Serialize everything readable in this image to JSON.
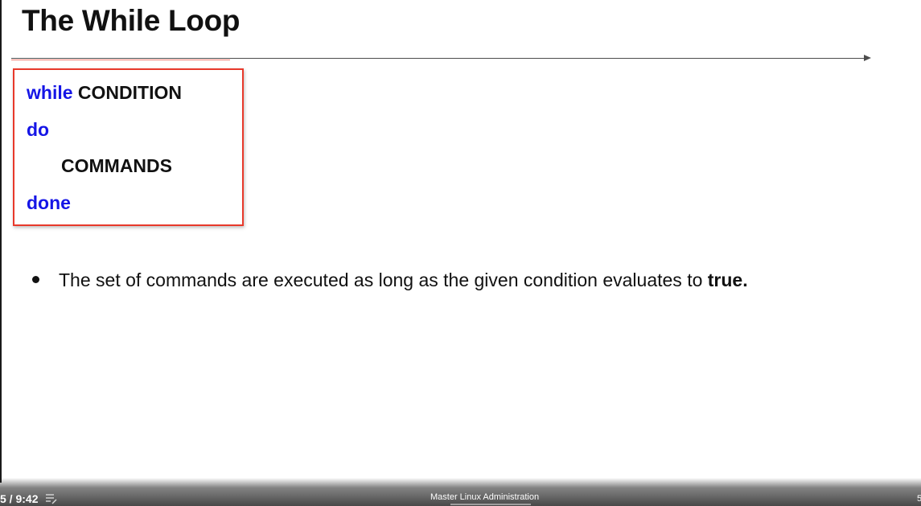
{
  "slide": {
    "title": "The While Loop",
    "syntax": {
      "kw_while": "while",
      "condition": "CONDITION",
      "kw_do": "do",
      "commands": "COMMANDS",
      "kw_done": "done"
    },
    "bullet": {
      "text": "The set of commands are executed as long as the given condition evaluates to ",
      "emphasis": "true."
    }
  },
  "player": {
    "time": "5 / 9:42",
    "course_title": "Master Linux Administration",
    "right_edge_text": "5"
  },
  "colors": {
    "keyword": "#1515e6",
    "box_border": "#e8392b",
    "accent_line": "#f07a6e"
  },
  "icons": {
    "playlist": "playlist-edit-icon",
    "bullet": "bullet-dot-icon",
    "rule_arrow": "arrow-right-icon"
  }
}
